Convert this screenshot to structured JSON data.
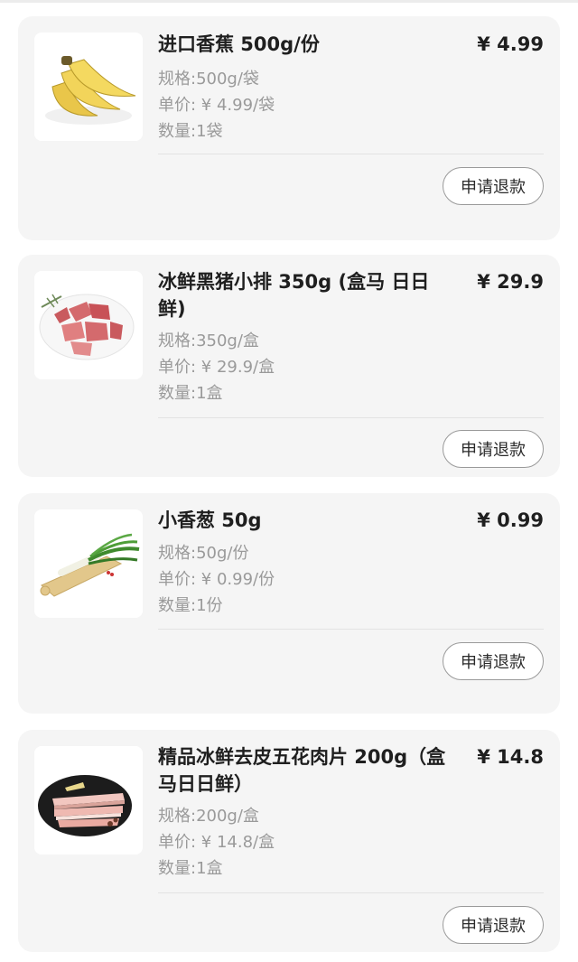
{
  "items": [
    {
      "title": "进口香蕉 500g/份",
      "price": "¥ 4.99",
      "spec": "规格:500g/袋",
      "unit_price": "单价: ¥ 4.99/袋",
      "quantity": "数量:1袋",
      "refund_label": "申请退款",
      "image_icon": "banana-image"
    },
    {
      "title": "冰鲜黑猪小排 350g (盒马 日日鲜)",
      "price": "¥ 29.9",
      "spec": "规格:350g/盒",
      "unit_price": "单价: ¥ 29.9/盒",
      "quantity": "数量:1盒",
      "refund_label": "申请退款",
      "image_icon": "pork-ribs-image"
    },
    {
      "title": "小香葱 50g",
      "price": "¥ 0.99",
      "spec": "规格:50g/份",
      "unit_price": "单价: ¥ 0.99/份",
      "quantity": "数量:1份",
      "refund_label": "申请退款",
      "image_icon": "scallion-image"
    },
    {
      "title": "精品冰鲜去皮五花肉片 200g（盒马日日鲜）",
      "price": "¥ 14.8",
      "spec": "规格:200g/盒",
      "unit_price": "单价: ¥ 14.8/盒",
      "quantity": "数量:1盒",
      "refund_label": "申请退款",
      "image_icon": "pork-belly-image"
    }
  ]
}
